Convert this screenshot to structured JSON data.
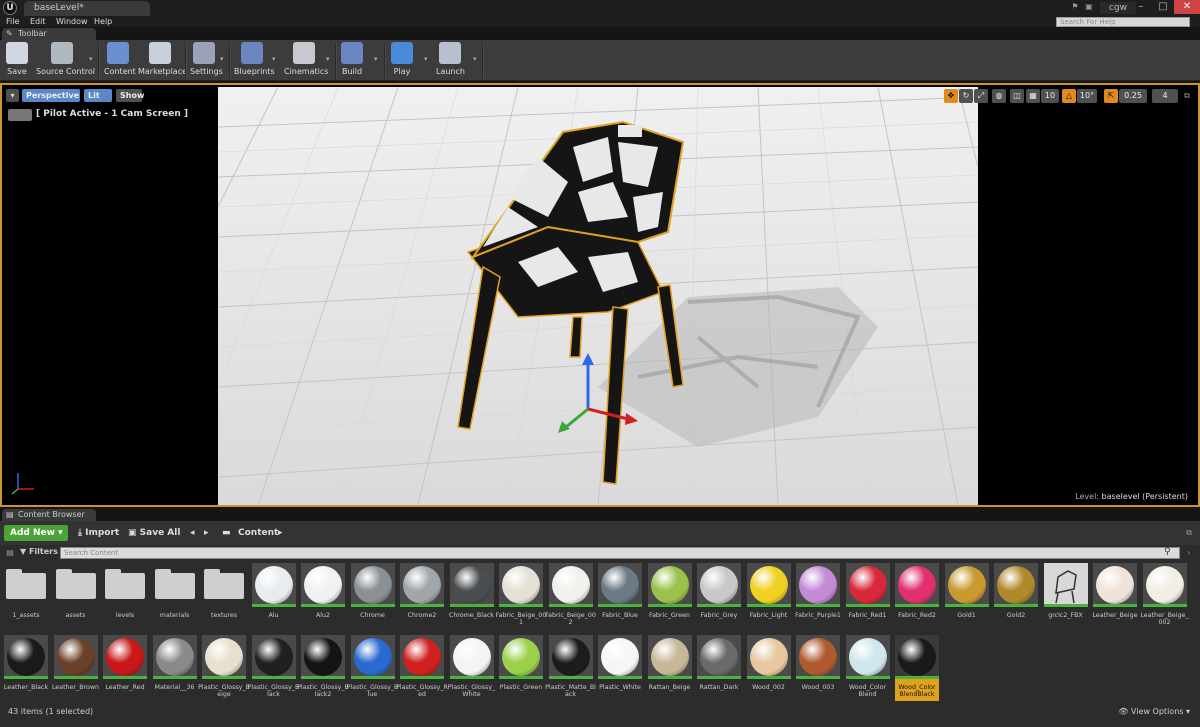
{
  "window": {
    "doc_tab": "baseLevel*",
    "user": "cgw",
    "help_search_placeholder": "Search For Help"
  },
  "menu": [
    "File",
    "Edit",
    "Window",
    "Help"
  ],
  "toolbar_tab": "Toolbar",
  "toolbar": [
    {
      "label": "Save",
      "icon": "save-icon",
      "color": "#cfd6e0"
    },
    {
      "label": "Source Control",
      "icon": "source-control-icon",
      "color": "#b0b8c0"
    },
    {
      "label": "Content",
      "icon": "content-icon",
      "color": "#6a8fd0"
    },
    {
      "label": "Marketplace",
      "icon": "marketplace-icon",
      "color": "#c8d0dc"
    },
    {
      "label": "Settings",
      "icon": "settings-icon",
      "color": "#9aa2b8"
    },
    {
      "label": "Blueprints",
      "icon": "blueprints-icon",
      "color": "#6a86c0"
    },
    {
      "label": "Cinematics",
      "icon": "cinematics-icon",
      "color": "#c8c8d0"
    },
    {
      "label": "Build",
      "icon": "build-icon",
      "color": "#6a86c0"
    },
    {
      "label": "Play",
      "icon": "play-icon",
      "color": "#4a8ad8"
    },
    {
      "label": "Launch",
      "icon": "launch-icon",
      "color": "#b8c0d0"
    }
  ],
  "viewport": {
    "perspective": "Perspective",
    "lit": "Lit",
    "show": "Show",
    "pilot": "[ Pilot Active - 1 Cam Screen ]",
    "snap_grid": "10",
    "snap_rot": "10°",
    "snap_scale": "0.25",
    "camera_speed": "4",
    "level_prefix": "Level:",
    "level_name": "baselevel (Persistent)"
  },
  "content_browser": {
    "tab": "Content Browser",
    "add_new": "Add New",
    "import": "Import",
    "save_all": "Save All",
    "path": "Content",
    "filters": "Filters",
    "search_placeholder": "Search Content",
    "status": "43 items (1 selected)",
    "view_options": "View Options"
  },
  "assets_row1": [
    {
      "name": "1_assets",
      "kind": "folder"
    },
    {
      "name": "assets",
      "kind": "folder"
    },
    {
      "name": "levels",
      "kind": "folder"
    },
    {
      "name": "materials",
      "kind": "folder"
    },
    {
      "name": "textures",
      "kind": "folder"
    },
    {
      "name": "Alu",
      "kind": "sphere",
      "color": "#e8ecee"
    },
    {
      "name": "Alu2",
      "kind": "sphere",
      "color": "#f0f2f2"
    },
    {
      "name": "Chrome",
      "kind": "sphere",
      "color": "#8a9094"
    },
    {
      "name": "Chrome2",
      "kind": "sphere",
      "color": "#a0a6aa"
    },
    {
      "name": "Chrome_Black",
      "kind": "sphere",
      "color": "#4a4e50"
    },
    {
      "name": "Fabric_Beige_001",
      "kind": "sphere",
      "color": "#e4e0d6"
    },
    {
      "name": "Fabric_Beige_002",
      "kind": "sphere",
      "color": "#f0f0ec"
    },
    {
      "name": "Fabric_Blue",
      "kind": "sphere",
      "color": "#6a7a86"
    },
    {
      "name": "Fabric_Green",
      "kind": "sphere",
      "color": "#9ac24a"
    },
    {
      "name": "Fabric_Grey",
      "kind": "sphere",
      "color": "#c8c8c8"
    },
    {
      "name": "Fabric_Light",
      "kind": "sphere",
      "color": "#f0d020"
    },
    {
      "name": "Fabric_Purple1",
      "kind": "sphere",
      "color": "#c48ad6"
    },
    {
      "name": "Fabric_Red1",
      "kind": "sphere",
      "color": "#d8283a"
    },
    {
      "name": "Fabric_Red2",
      "kind": "sphere",
      "color": "#e03070"
    },
    {
      "name": "Gold1",
      "kind": "sphere",
      "color": "#c89a30"
    },
    {
      "name": "Gold2",
      "kind": "sphere",
      "color": "#b08a2a"
    },
    {
      "name": "grclc2_FBX",
      "kind": "mesh",
      "color": "#d8d8d8"
    },
    {
      "name": "Leather_Beige",
      "kind": "sphere",
      "color": "#f0e4da"
    },
    {
      "name": "Leather_Beige_002",
      "kind": "sphere",
      "color": "#f2eee6"
    }
  ],
  "assets_row2": [
    {
      "name": "Leather_Black",
      "color": "#1a1a1a"
    },
    {
      "name": "Leather_Brown",
      "color": "#6a4028"
    },
    {
      "name": "Leather_Red",
      "color": "#c81818"
    },
    {
      "name": "Material__36",
      "color": "#8a8a8a"
    },
    {
      "name": "Plastic_Glossy_Beige",
      "color": "#e8e0cc"
    },
    {
      "name": "Plastic_Glossy_Black",
      "color": "#202020"
    },
    {
      "name": "Plastic_Glossy_Black2",
      "color": "#141414"
    },
    {
      "name": "Plastic_Glossy_Blue",
      "color": "#2a6ad0"
    },
    {
      "name": "Plastic_Glossy_Red",
      "color": "#d02020"
    },
    {
      "name": "Plastic_Glossy_White",
      "color": "#f4f4f4"
    },
    {
      "name": "Plastic_Green",
      "color": "#9ad04a"
    },
    {
      "name": "Plastic_Matte_Black",
      "color": "#1c1c1c"
    },
    {
      "name": "Plastic_White",
      "color": "#f6f6f6"
    },
    {
      "name": "Rattan_Beige",
      "color": "#c8b89a"
    },
    {
      "name": "Rattan_Dark",
      "color": "#6a6a6a"
    },
    {
      "name": "Wood_002",
      "color": "#e8c8a0"
    },
    {
      "name": "Wood_003",
      "color": "#b05a30"
    },
    {
      "name": "Wood_Color Blend",
      "color": "#cfe6ec"
    },
    {
      "name": "Wood_Color BlendBlack",
      "color": "#1a1a1a",
      "selected": true
    }
  ]
}
